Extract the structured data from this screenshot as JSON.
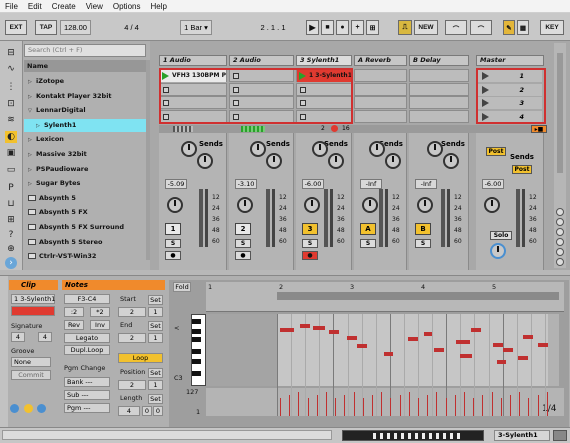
{
  "menu": [
    "File",
    "Edit",
    "Create",
    "View",
    "Options",
    "Help"
  ],
  "transport": {
    "ext": "EXT",
    "tap": "TAP",
    "tempo": "128.00",
    "sig": "4 / 4",
    "quant": "1 Bar ▾",
    "position": "2 .  1 .  1",
    "new": "NEW",
    "key": "KEY"
  },
  "browser": {
    "search_placeholder": "Search (Ctrl + F)",
    "column": "Name",
    "items": [
      {
        "label": "iZotope",
        "type": "folder"
      },
      {
        "label": "Kontakt Player 32bit",
        "type": "folder"
      },
      {
        "label": "LennarDigital",
        "type": "folder-open"
      },
      {
        "label": "Sylenth1",
        "type": "sub",
        "selected": true
      },
      {
        "label": "Lexicon",
        "type": "folder"
      },
      {
        "label": "Massive 32bit",
        "type": "folder"
      },
      {
        "label": "PSPaudioware",
        "type": "folder"
      },
      {
        "label": "Sugar Bytes",
        "type": "folder"
      },
      {
        "label": "Absynth 5",
        "type": "plugin"
      },
      {
        "label": "Absynth 5 FX",
        "type": "plugin"
      },
      {
        "label": "Absynth 5 FX Surround",
        "type": "plugin"
      },
      {
        "label": "Absynth 5 Stereo",
        "type": "plugin"
      },
      {
        "label": "Ctrlr-VST-Win32",
        "type": "plugin"
      }
    ]
  },
  "tracks": [
    {
      "name": "1 Audio",
      "clip": "VFH3 130BPM P",
      "clip_color": "#eaeaea",
      "num": "1",
      "vol": "-5.09"
    },
    {
      "name": "2 Audio",
      "clip": "",
      "num": "2",
      "vol": "-3.10"
    },
    {
      "name": "3 Sylenth1",
      "clip": "1 3-Sylenth1",
      "clip_color": "#e03a30",
      "num": "3",
      "vol": "-6.00",
      "selected": true
    },
    {
      "name": "A Reverb",
      "num": "A",
      "vol": "-Inf"
    },
    {
      "name": "B Delay",
      "num": "B",
      "vol": "-Inf"
    },
    {
      "name": "Master",
      "vol": "-6.00"
    }
  ],
  "scenes": [
    "1",
    "2",
    "3",
    "4"
  ],
  "mixer": {
    "sends": "Sends",
    "post": "Post",
    "solo": "Solo",
    "s": "S",
    "ticks": [
      "12",
      "24",
      "36",
      "48",
      "60"
    ],
    "misc_counts": [
      "2",
      "16"
    ]
  },
  "clip": {
    "title": "Clip",
    "name": "1 3-Sylenth1",
    "signature_label": "Signature",
    "sig_num": "4",
    "sig_den": "4",
    "groove_label": "Groove",
    "groove": "None",
    "commit": "Commit"
  },
  "notes": {
    "title": "Notes",
    "range": "F3-C4",
    "b1": ":2",
    "b2": "*2",
    "rev": "Rev",
    "inv": "Inv",
    "legato": "Legato",
    "dupl": "Dupl.Loop",
    "pgm": "Pgm Change",
    "bank": "Bank ---",
    "sub": "Sub ---",
    "pgmv": "Pgm ---",
    "start": "Start",
    "start_v": "2",
    "end": "End",
    "end_v": "2",
    "loop": "Loop",
    "position": "Position",
    "pos_v": "2",
    "length": "Length",
    "len_v": "4",
    "set": "Set",
    "one": "1",
    "zero": "0"
  },
  "editor": {
    "fold": "Fold",
    "ruler": [
      "1",
      "2",
      "3",
      "4",
      "5"
    ],
    "c3": "C3",
    "vel_top": "127",
    "vel_bottom": "1",
    "zoom": "1/4"
  },
  "status": {
    "track": "3-Sylenth1"
  }
}
